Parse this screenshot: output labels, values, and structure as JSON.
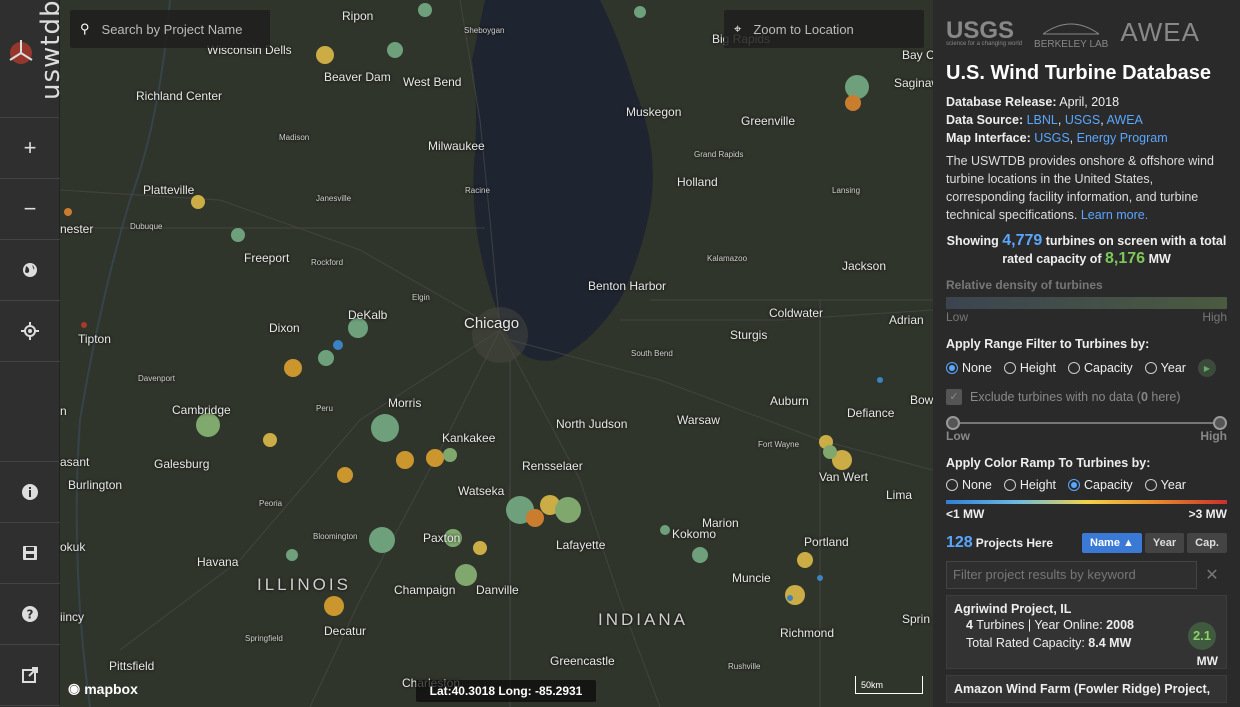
{
  "app": {
    "logo": "uswtdb"
  },
  "sidebar": {
    "buttons": [
      {
        "name": "zoom-in-button",
        "glyph": "+"
      },
      {
        "name": "zoom-out-button",
        "glyph": "−"
      },
      {
        "name": "basemap-button",
        "glyph": "◕"
      },
      {
        "name": "locate-button",
        "glyph": "⌖"
      }
    ],
    "lower_buttons": [
      {
        "name": "info-button",
        "glyph": "i"
      },
      {
        "name": "save-button",
        "glyph": "▤"
      },
      {
        "name": "help-button",
        "glyph": "?"
      },
      {
        "name": "external-link-button",
        "glyph": "↗"
      }
    ]
  },
  "map": {
    "search_placeholder": "Search by Project Name",
    "zoom_placeholder": "Zoom to Location",
    "attribution": "mapbox",
    "coords": "Lat:40.3018  Long: -85.2931",
    "scale": "50km",
    "state_labels": [
      "ILLINOIS",
      "INDIANA"
    ],
    "places": [
      "Ripon",
      "Sheboygan",
      "Big Rapids",
      "Bay C",
      "Wisconsin Dells",
      "Beaver Dam",
      "West Bend",
      "Saginaw",
      "Richland Center",
      "Muskegon",
      "Greenville",
      "Madison",
      "Milwaukee",
      "Grand Rapids",
      "Platteville",
      "Janesville",
      "Racine",
      "Holland",
      "Lansing",
      "nester",
      "Dubuque",
      "Freeport",
      "Rockford",
      "Kalamazoo",
      "Jackson",
      "Elgin",
      "Benton Harbor",
      "DeKalb",
      "Coldwater",
      "Adrian",
      "Tipton",
      "Dixon",
      "Chicago",
      "Sturgis",
      "South Bend",
      "Davenport",
      "Morris",
      "Auburn",
      "Defiance",
      "Bow",
      "Cambridge",
      "Peru",
      "North Judson",
      "Warsaw",
      "n",
      "Kankakee",
      "Fort Wayne",
      "asant",
      "Galesburg",
      "Rensselaer",
      "Van Wert",
      "Burlington",
      "Watseka",
      "Lima",
      "Peoria",
      "Marion",
      "okuk",
      "Bloomington",
      "Paxton",
      "Kokomo",
      "Portland",
      "Lafayette",
      "Havana",
      "Muncie",
      "Champaign",
      "Danville",
      "iincy",
      "Springfield",
      "Decatur",
      "Richmond",
      "Sprin",
      "Pittsfield",
      "Greencastle",
      "Rushville",
      "Charleston"
    ]
  },
  "panel": {
    "logos": {
      "usgs": "USGS",
      "usgs_tag": "science for a changing world",
      "berkeley": "BERKELEY LAB",
      "awea": "AWEA"
    },
    "title": "U.S. Wind Turbine Database",
    "release_label": "Database Release:",
    "release_value": "April, 2018",
    "source_label": "Data Source:",
    "source_links": [
      "LBNL",
      "USGS",
      "AWEA"
    ],
    "interface_label": "Map Interface:",
    "interface_links": [
      "USGS",
      "Energy Program"
    ],
    "description": "The USWTDB provides onshore & offshore wind turbine locations in the United States, corresponding facility information, and turbine technical specifications.",
    "learn_more": "Learn more.",
    "showing_prefix": "Showing",
    "turbine_count": "4,779",
    "showing_mid": "turbines on screen with a total rated capacity of",
    "capacity_total": "8,176",
    "capacity_unit": "MW",
    "density_title": "Relative density of turbines",
    "density_low": "Low",
    "density_high": "High",
    "range_title": "Apply Range Filter to Turbines by:",
    "range_options": [
      "None",
      "Height",
      "Capacity",
      "Year"
    ],
    "range_selected": "None",
    "exclude_label": "Exclude turbines with no data (",
    "exclude_count": "0",
    "exclude_suffix": " here)",
    "slider_low": "Low",
    "slider_high": "High",
    "ramp_title": "Apply Color Ramp To Turbines by:",
    "ramp_options": [
      "None",
      "Height",
      "Capacity",
      "Year"
    ],
    "ramp_selected": "Capacity",
    "ramp_low": "<1 MW",
    "ramp_high": ">3 MW",
    "project_count": "128",
    "project_label": "Projects Here",
    "sort_buttons": [
      "Name ▲",
      "Year",
      "Cap."
    ],
    "filter_placeholder": "Filter project results by keyword",
    "cards": [
      {
        "title": "Agriwind Project, IL",
        "turbines": "4",
        "turbines_label": "Turbines | Year Online:",
        "year": "2008",
        "cap_label": "Total Rated Capacity:",
        "cap_value": "8.4 MW",
        "badge": "2.1",
        "badge_unit": "MW"
      },
      {
        "title": "Amazon Wind Farm (Fowler Ridge) Project,"
      }
    ]
  },
  "colors": {
    "accent_blue": "#5aa7ff",
    "accent_green": "#7ec85a",
    "active_sort": "#3a7ad6"
  }
}
